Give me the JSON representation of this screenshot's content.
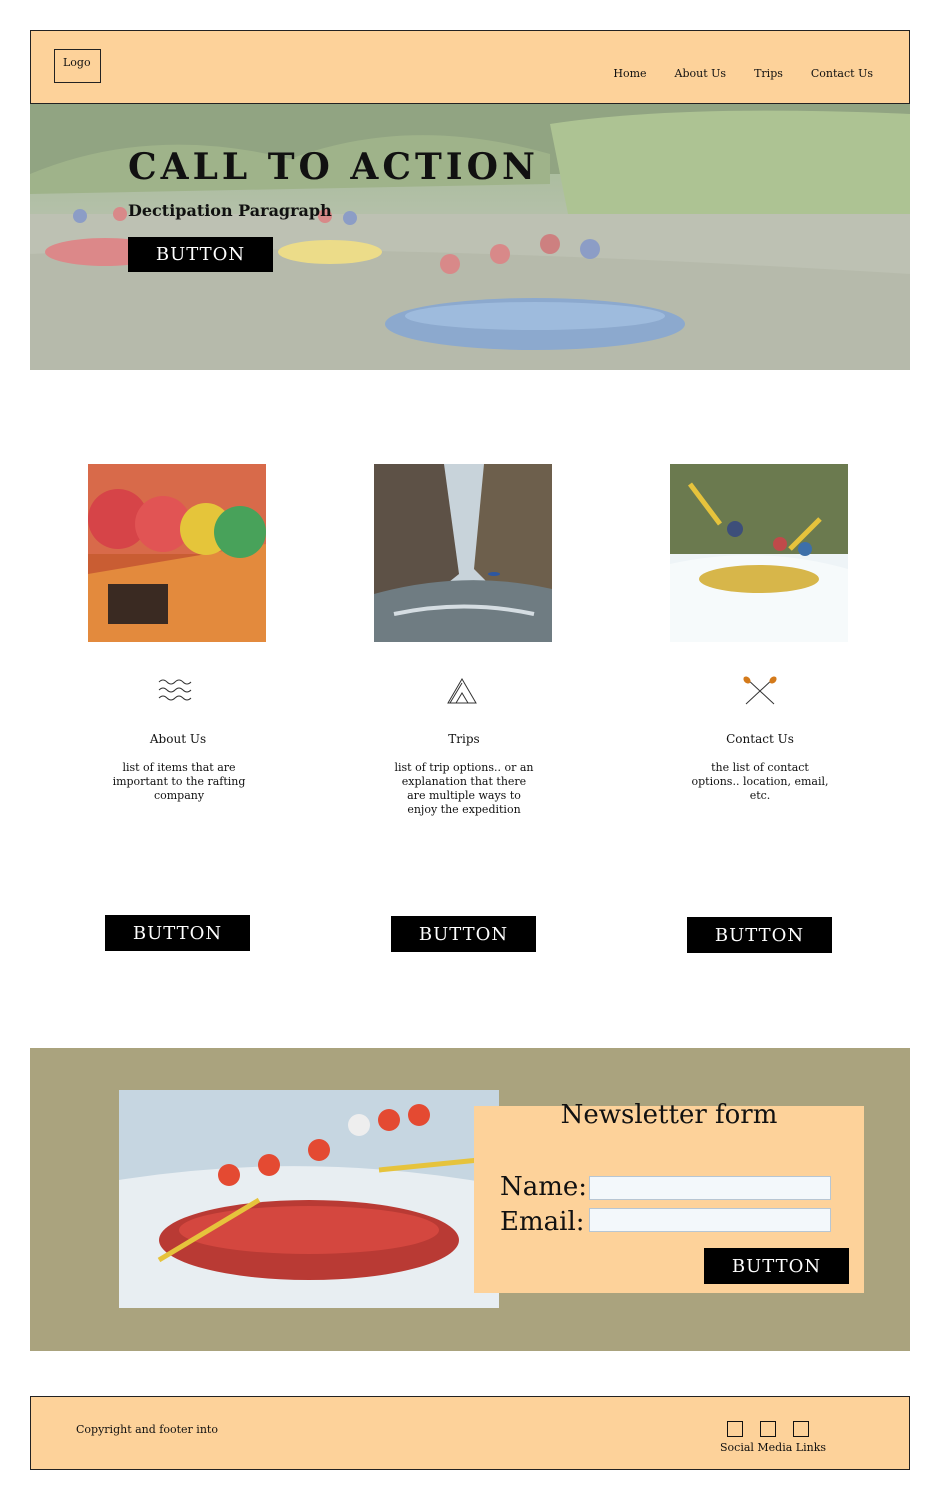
{
  "header": {
    "logo": "Logo",
    "nav": [
      "Home",
      "About Us",
      "Trips",
      "Contact Us"
    ]
  },
  "hero": {
    "title": "CALL TO ACTION",
    "subtitle": "Dectipation Paragraph",
    "button": "BUTTON"
  },
  "cards": [
    {
      "icon": "waves-icon",
      "title": "About Us",
      "text": "list of items that are important to the rafting company",
      "button": "BUTTON"
    },
    {
      "icon": "mountain-icon",
      "title": "Trips",
      "text": "list of trip options.. or an explanation that there are multiple ways to enjoy the expedition",
      "button": "BUTTON"
    },
    {
      "icon": "crossed-paddles-icon",
      "title": "Contact Us",
      "text": "the list of contact options.. location, email, etc.",
      "button": "BUTTON"
    }
  ],
  "newsletter": {
    "title": "Newsletter form",
    "name_label": "Name:",
    "email_label": "Email:",
    "name_value": "",
    "email_value": "",
    "button": "BUTTON"
  },
  "footer": {
    "copyright": "Copyright and footer into",
    "social_label": "Social Media Links"
  },
  "colors": {
    "peach": "#fdd29a",
    "olive": "#aaa37e",
    "button": "#000000"
  }
}
